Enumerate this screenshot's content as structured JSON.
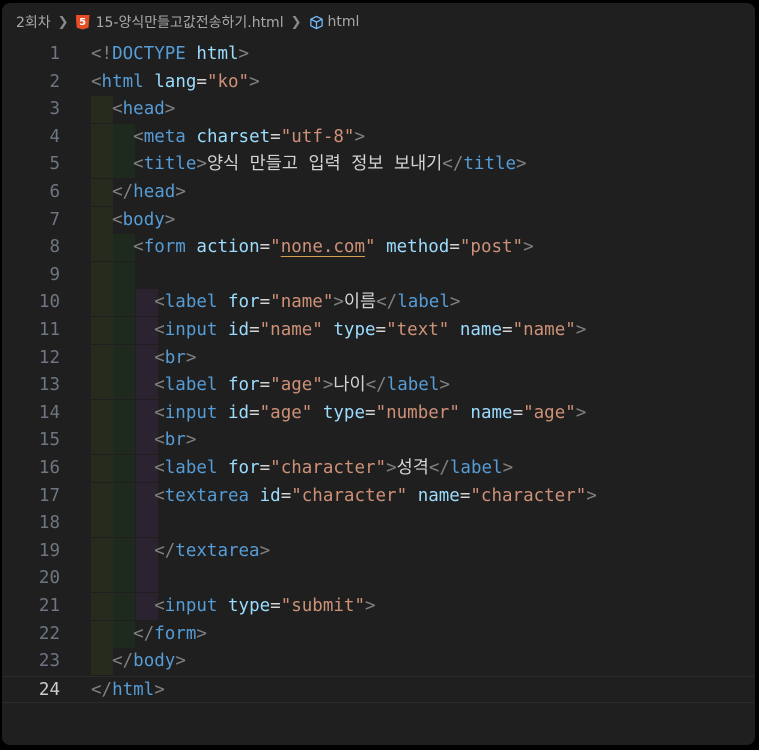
{
  "breadcrumb": {
    "folder": "2회차",
    "file": "15-양식만들고값전송하기.html",
    "symbol": "html"
  },
  "editor": {
    "language": "html",
    "current_line": 24,
    "lines": [
      {
        "n": "1",
        "tokens": [
          [
            "br",
            "<!"
          ],
          [
            "tag",
            "DOCTYPE"
          ],
          [
            "txt",
            " "
          ],
          [
            "attr",
            "html"
          ],
          [
            "br",
            ">"
          ]
        ]
      },
      {
        "n": "2",
        "tokens": [
          [
            "br",
            "<"
          ],
          [
            "tag",
            "html"
          ],
          [
            "txt",
            " "
          ],
          [
            "attr",
            "lang"
          ],
          [
            "txt",
            "="
          ],
          [
            "str",
            "\"ko\""
          ],
          [
            "br",
            ">"
          ]
        ]
      },
      {
        "n": "3",
        "tokens": [
          [
            "txt",
            "  "
          ],
          [
            "br",
            "<"
          ],
          [
            "tag",
            "head"
          ],
          [
            "br",
            ">"
          ]
        ]
      },
      {
        "n": "4",
        "tokens": [
          [
            "txt",
            "    "
          ],
          [
            "br",
            "<"
          ],
          [
            "tag",
            "meta"
          ],
          [
            "txt",
            " "
          ],
          [
            "attr",
            "charset"
          ],
          [
            "txt",
            "="
          ],
          [
            "str",
            "\"utf-8\""
          ],
          [
            "br",
            ">"
          ]
        ]
      },
      {
        "n": "5",
        "tokens": [
          [
            "txt",
            "    "
          ],
          [
            "br",
            "<"
          ],
          [
            "tag",
            "title"
          ],
          [
            "br",
            ">"
          ],
          [
            "txt",
            "양식 만들고 입력 정보 보내기"
          ],
          [
            "br",
            "</"
          ],
          [
            "tag",
            "title"
          ],
          [
            "br",
            ">"
          ]
        ]
      },
      {
        "n": "6",
        "tokens": [
          [
            "txt",
            "  "
          ],
          [
            "br",
            "</"
          ],
          [
            "tag",
            "head"
          ],
          [
            "br",
            ">"
          ]
        ]
      },
      {
        "n": "7",
        "tokens": [
          [
            "txt",
            "  "
          ],
          [
            "br",
            "<"
          ],
          [
            "tag",
            "body"
          ],
          [
            "br",
            ">"
          ]
        ]
      },
      {
        "n": "8",
        "tokens": [
          [
            "txt",
            "    "
          ],
          [
            "br",
            "<"
          ],
          [
            "tag",
            "form"
          ],
          [
            "txt",
            " "
          ],
          [
            "attr",
            "action"
          ],
          [
            "txt",
            "="
          ],
          [
            "str",
            "\""
          ],
          [
            "stru",
            "none.com"
          ],
          [
            "str",
            "\""
          ],
          [
            "txt",
            " "
          ],
          [
            "attr",
            "method"
          ],
          [
            "txt",
            "="
          ],
          [
            "str",
            "\"post\""
          ],
          [
            "br",
            ">"
          ]
        ]
      },
      {
        "n": "9",
        "tokens": []
      },
      {
        "n": "10",
        "tokens": [
          [
            "txt",
            "      "
          ],
          [
            "br",
            "<"
          ],
          [
            "tag",
            "label"
          ],
          [
            "txt",
            " "
          ],
          [
            "attr",
            "for"
          ],
          [
            "txt",
            "="
          ],
          [
            "str",
            "\"name\""
          ],
          [
            "br",
            ">"
          ],
          [
            "txt",
            "이름"
          ],
          [
            "br",
            "</"
          ],
          [
            "tag",
            "label"
          ],
          [
            "br",
            ">"
          ]
        ]
      },
      {
        "n": "11",
        "tokens": [
          [
            "txt",
            "      "
          ],
          [
            "br",
            "<"
          ],
          [
            "tag",
            "input"
          ],
          [
            "txt",
            " "
          ],
          [
            "attr",
            "id"
          ],
          [
            "txt",
            "="
          ],
          [
            "str",
            "\"name\""
          ],
          [
            "txt",
            " "
          ],
          [
            "attr",
            "type"
          ],
          [
            "txt",
            "="
          ],
          [
            "str",
            "\"text\""
          ],
          [
            "txt",
            " "
          ],
          [
            "attr",
            "name"
          ],
          [
            "txt",
            "="
          ],
          [
            "str",
            "\"name\""
          ],
          [
            "br",
            ">"
          ]
        ]
      },
      {
        "n": "12",
        "tokens": [
          [
            "txt",
            "      "
          ],
          [
            "br",
            "<"
          ],
          [
            "tag",
            "br"
          ],
          [
            "br",
            ">"
          ]
        ]
      },
      {
        "n": "13",
        "tokens": [
          [
            "txt",
            "      "
          ],
          [
            "br",
            "<"
          ],
          [
            "tag",
            "label"
          ],
          [
            "txt",
            " "
          ],
          [
            "attr",
            "for"
          ],
          [
            "txt",
            "="
          ],
          [
            "str",
            "\"age\""
          ],
          [
            "br",
            ">"
          ],
          [
            "txt",
            "나이"
          ],
          [
            "br",
            "</"
          ],
          [
            "tag",
            "label"
          ],
          [
            "br",
            ">"
          ]
        ]
      },
      {
        "n": "14",
        "tokens": [
          [
            "txt",
            "      "
          ],
          [
            "br",
            "<"
          ],
          [
            "tag",
            "input"
          ],
          [
            "txt",
            " "
          ],
          [
            "attr",
            "id"
          ],
          [
            "txt",
            "="
          ],
          [
            "str",
            "\"age\""
          ],
          [
            "txt",
            " "
          ],
          [
            "attr",
            "type"
          ],
          [
            "txt",
            "="
          ],
          [
            "str",
            "\"number\""
          ],
          [
            "txt",
            " "
          ],
          [
            "attr",
            "name"
          ],
          [
            "txt",
            "="
          ],
          [
            "str",
            "\"age\""
          ],
          [
            "br",
            ">"
          ]
        ]
      },
      {
        "n": "15",
        "tokens": [
          [
            "txt",
            "      "
          ],
          [
            "br",
            "<"
          ],
          [
            "tag",
            "br"
          ],
          [
            "br",
            ">"
          ]
        ]
      },
      {
        "n": "16",
        "tokens": [
          [
            "txt",
            "      "
          ],
          [
            "br",
            "<"
          ],
          [
            "tag",
            "label"
          ],
          [
            "txt",
            " "
          ],
          [
            "attr",
            "for"
          ],
          [
            "txt",
            "="
          ],
          [
            "str",
            "\"character\""
          ],
          [
            "br",
            ">"
          ],
          [
            "txt",
            "성격"
          ],
          [
            "br",
            "</"
          ],
          [
            "tag",
            "label"
          ],
          [
            "br",
            ">"
          ]
        ]
      },
      {
        "n": "17",
        "tokens": [
          [
            "txt",
            "      "
          ],
          [
            "br",
            "<"
          ],
          [
            "tag",
            "textarea"
          ],
          [
            "txt",
            " "
          ],
          [
            "attr",
            "id"
          ],
          [
            "txt",
            "="
          ],
          [
            "str",
            "\"character\""
          ],
          [
            "txt",
            " "
          ],
          [
            "attr",
            "name"
          ],
          [
            "txt",
            "="
          ],
          [
            "str",
            "\"character\""
          ],
          [
            "br",
            ">"
          ]
        ]
      },
      {
        "n": "18",
        "tokens": []
      },
      {
        "n": "19",
        "tokens": [
          [
            "txt",
            "      "
          ],
          [
            "br",
            "</"
          ],
          [
            "tag",
            "textarea"
          ],
          [
            "br",
            ">"
          ]
        ]
      },
      {
        "n": "20",
        "tokens": []
      },
      {
        "n": "21",
        "tokens": [
          [
            "txt",
            "      "
          ],
          [
            "br",
            "<"
          ],
          [
            "tag",
            "input"
          ],
          [
            "txt",
            " "
          ],
          [
            "attr",
            "type"
          ],
          [
            "txt",
            "="
          ],
          [
            "str",
            "\"submit\""
          ],
          [
            "br",
            ">"
          ]
        ]
      },
      {
        "n": "22",
        "tokens": [
          [
            "txt",
            "    "
          ],
          [
            "br",
            "</"
          ],
          [
            "tag",
            "form"
          ],
          [
            "br",
            ">"
          ]
        ]
      },
      {
        "n": "23",
        "tokens": [
          [
            "txt",
            "  "
          ],
          [
            "br",
            "</"
          ],
          [
            "tag",
            "body"
          ],
          [
            "br",
            ">"
          ]
        ]
      },
      {
        "n": "24",
        "tokens": [
          [
            "br",
            "</"
          ],
          [
            "tag",
            "html"
          ],
          [
            "br",
            ">"
          ]
        ]
      }
    ]
  },
  "colors": {
    "tag": "#569cd6",
    "bracket": "#808080",
    "attribute": "#9cdcfe",
    "string": "#ce9178",
    "text": "#d4d4d4",
    "indent_level_1": "#262b1e",
    "indent_level_2": "#1f2a1f",
    "indent_level_3": "#2c2330"
  }
}
